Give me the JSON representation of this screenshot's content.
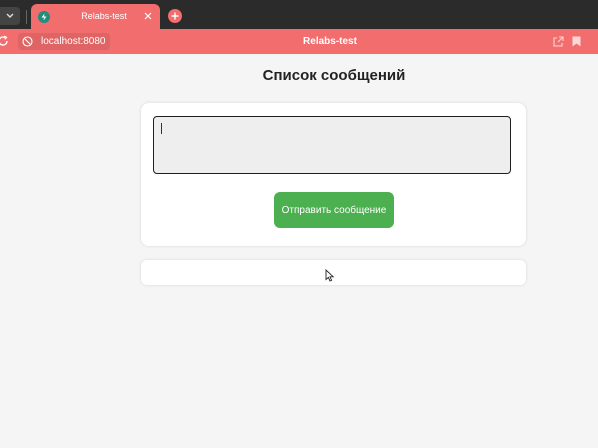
{
  "browser": {
    "tab": {
      "title": "Relabs-test"
    },
    "address": {
      "url": "localhost:8080"
    },
    "title_bar": "Relabs-test",
    "colors": {
      "accent": "#f26d6d",
      "tabstrip": "#2b2b2b"
    }
  },
  "page": {
    "heading": "Список сообщений",
    "form": {
      "message_value": "",
      "send_label": "Отправить сообщение",
      "send_color": "#4caf50"
    },
    "messages": []
  }
}
